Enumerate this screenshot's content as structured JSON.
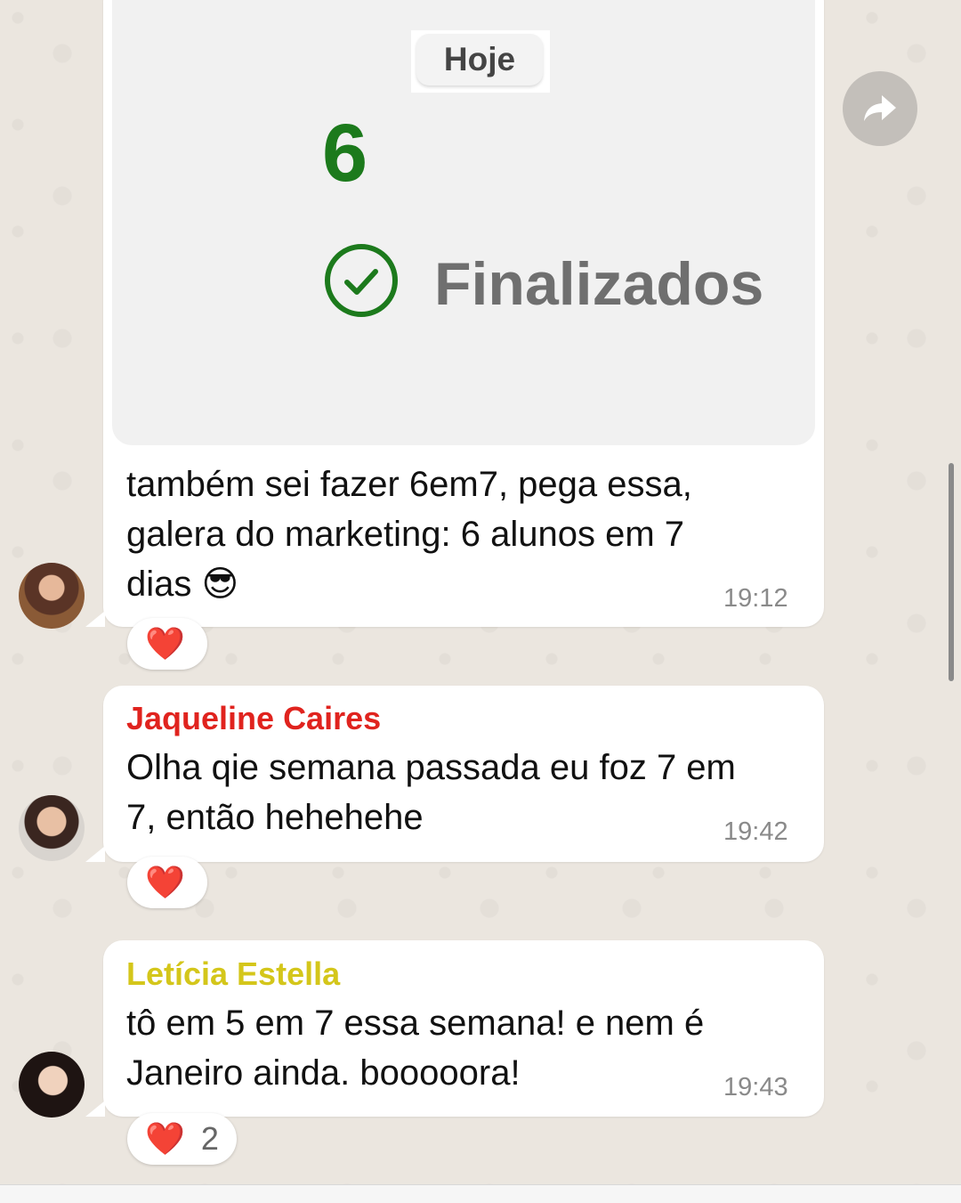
{
  "date_chip": "Hoje",
  "shared_card": {
    "count": "6",
    "status_label": "Finalizados",
    "status_color": "#1c7a1c"
  },
  "messages": [
    {
      "sender": "",
      "text_lines": [
        "também sei fazer 6em7, pega essa,",
        "galera do marketing: 6 alunos em 7",
        "dias 😎"
      ],
      "time": "19:12",
      "reaction": {
        "emoji": "❤️",
        "count": ""
      }
    },
    {
      "sender": "Jaqueline Caires",
      "sender_color": "#e0231e",
      "text_lines": [
        "Olha qie semana passada eu foz 7 em",
        "7, então hehehehe"
      ],
      "time": "19:42",
      "reaction": {
        "emoji": "❤️",
        "count": ""
      }
    },
    {
      "sender": "Letícia Estella",
      "sender_color": "#d4c61a",
      "text_lines": [
        "tô em 5 em 7 essa semana! e nem é",
        "Janeiro ainda. booooora!"
      ],
      "time": "19:43",
      "reaction": {
        "emoji": "❤️",
        "count": "2"
      }
    }
  ],
  "icons": {
    "forward": "forward-arrow-icon",
    "check": "check-circle-icon",
    "heart": "heart-icon"
  }
}
